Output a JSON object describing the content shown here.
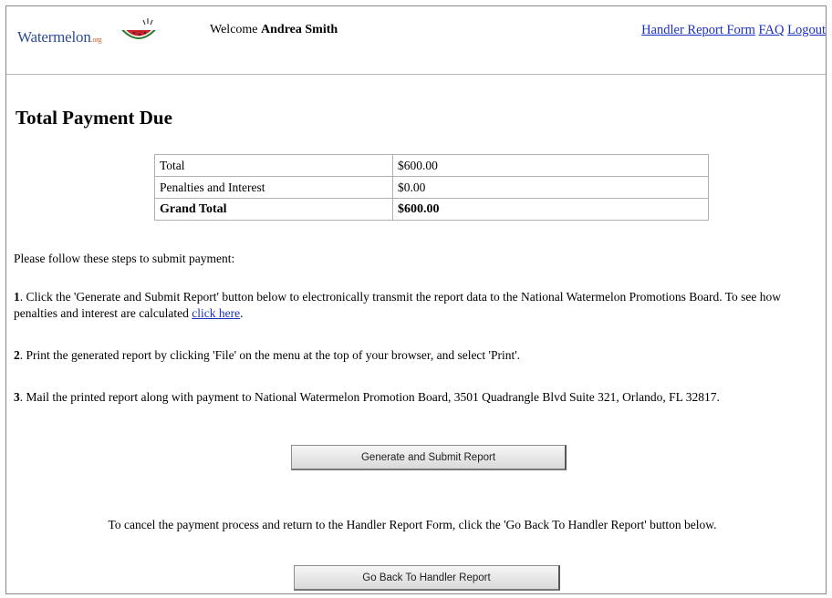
{
  "header": {
    "logo_text": "Watermelon",
    "logo_tld": ".org",
    "welcome_prefix": "Welcome",
    "user_name": "Andrea Smith",
    "links": [
      "Handler Report Form",
      "FAQ",
      "Logout"
    ]
  },
  "page_title": "Total Payment Due",
  "summary": {
    "rows": [
      {
        "label": "Total",
        "value": "$600.00"
      },
      {
        "label": "Penalties and Interest",
        "value": "$0.00"
      },
      {
        "label": "Grand Total",
        "value": "$600.00"
      }
    ]
  },
  "instructions": {
    "intro": "Please follow these steps to submit payment:",
    "step1_num": "1",
    "step1_text": ". Click the 'Generate and Submit Report' button below to electronically transmit the report data to the National Watermelon Promotions Board. To see how penalties and interest are calculated",
    "step1_link": "click here",
    "step2_num": "2",
    "step2_text": ". Print the generated report by clicking 'File' on the menu at the top of your browser, and select 'Print'.",
    "step3_num": "3",
    "step3_text": ". Mail the printed report along with payment to National Watermelon Promotion Board, 3501 Quadrangle Blvd Suite 321, Orlando, FL 32817."
  },
  "buttons": {
    "generate": "Generate and Submit Report",
    "go_back": "Go Back To Handler Report"
  },
  "cancel_text": "To cancel the payment process and return to the Handler Report Form, click the 'Go Back To Handler Report' button below.",
  "colors": {
    "link": "#1a2fc2",
    "logo_text": "#2e4c93",
    "melon_red": "#c8232c",
    "rind_green": "#2f7a2c"
  },
  "icons": [
    "watermelon-slice-icon"
  ]
}
